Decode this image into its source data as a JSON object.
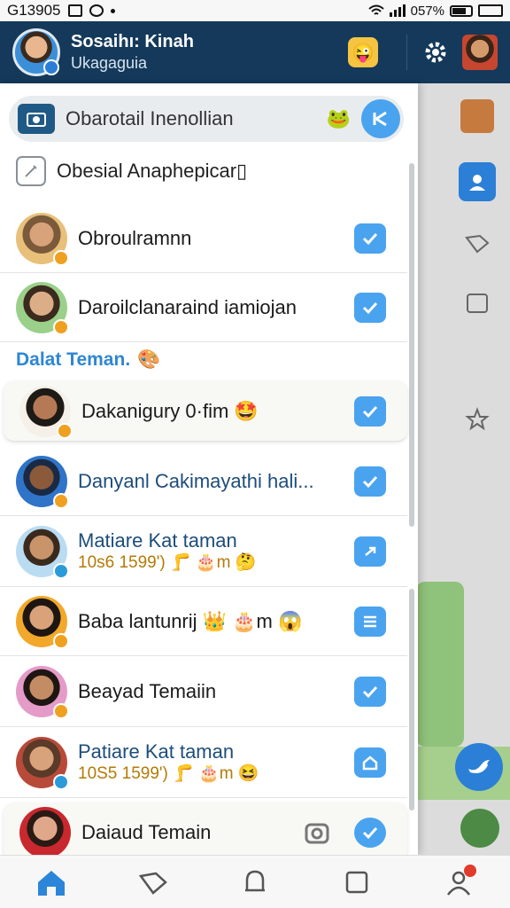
{
  "status_bar": {
    "time": "G13905"
  },
  "header": {
    "name": "Sosaihı: Kinah",
    "subtitle": "Ukagaguia",
    "emoji": "😜"
  },
  "search": {
    "text": "Obarotail Inenollian",
    "emoji": "🐸"
  },
  "section_top": {
    "label": "Obesial Anaphepicar▯"
  },
  "section_label": {
    "text": "Dalat Teman.",
    "emoji": "🎨"
  },
  "contacts": [
    {
      "name": "Obroulramnn",
      "meta": "",
      "action": "check"
    },
    {
      "name": "Daroilclanaraind iamiojan",
      "meta": "",
      "action": "check"
    },
    {
      "name": "Dakanigury 0·fim 🤩",
      "meta": "",
      "action": "check"
    },
    {
      "name": "Danyanl Cakimayathi hali...",
      "meta": "",
      "action": "check"
    },
    {
      "name": "Matiare Kat taman",
      "meta": "10s6 1599') 🦵 🎂m 🤔",
      "action": "send"
    },
    {
      "name": "Baba lantunrij 👑 🎂m 😱",
      "meta": "",
      "action": "list"
    },
    {
      "name": "Beayad Temaiin",
      "meta": "",
      "action": "check"
    },
    {
      "name": "Patiare Kat taman",
      "meta": "10S5 1599') 🦵 🎂m 😆",
      "action": "home"
    },
    {
      "name": "Daiaud Temain",
      "meta": "",
      "action": "check"
    }
  ],
  "colors": {
    "header": "#14395a",
    "accent": "#4aa3ee",
    "label": "#2f86d3"
  },
  "nav": [
    "home-icon",
    "tag-icon",
    "bell-icon",
    "square-icon",
    "profile-icon"
  ]
}
